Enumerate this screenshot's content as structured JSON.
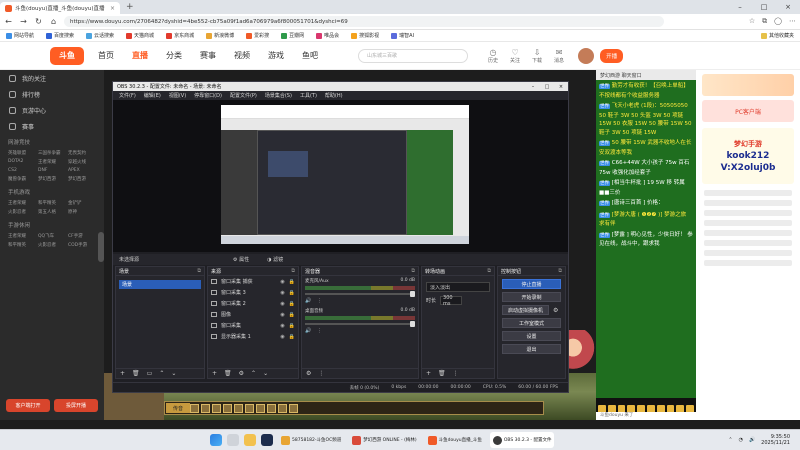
{
  "browser": {
    "tabs": [
      {
        "label": "斗鱼(douyu)直播_斗鱼(douyu)直播",
        "active": true
      },
      {
        "label": "+"
      }
    ],
    "url": "https://www.douyu.com/2706482?dyshid=4be552-cb75a09f1ad6a706979a6f800051701&dyshci=69",
    "bookmarks": [
      "网站导航",
      "百度搜索",
      "云话搜索",
      "天猫商城",
      "京东商城",
      "新浪微博",
      "爱彩搜",
      "豆瓣网",
      "唯品会",
      "搜狐影视",
      "瑞智AI"
    ],
    "bookmark_right": "其他收藏夹"
  },
  "douyu": {
    "logo": "斗鱼",
    "nav": [
      "首页",
      "直播",
      "分类",
      "赛事",
      "视频",
      "游戏",
      "鱼吧"
    ],
    "active_nav": "直播",
    "search_placeholder": "山东城三百歌",
    "header_icons": [
      "历史",
      "关注",
      "下载",
      "消息"
    ],
    "kaibo": "开播",
    "sidebar": {
      "items": [
        "我的关注",
        "排行榜",
        "页游中心",
        "赛事"
      ],
      "sections": [
        {
          "title": "网游竞技",
          "items": [
            "英雄联盟",
            "三国杀争霸",
            "无畏契约",
            "DOTA2",
            "王者荣耀",
            "穿越火线",
            "CS2",
            "DNF",
            "APEX",
            "魔兽争霸",
            "梦幻西游",
            "梦幻西游"
          ]
        },
        {
          "title": "手机游戏",
          "items": [
            "王者荣耀",
            "和平精英",
            "金铲铲",
            "火影忍者",
            "第五人格",
            "原神"
          ]
        },
        {
          "title": "手游休闲",
          "items": [
            "王者荣耀",
            "QQ飞车",
            "CF手游",
            "和平精英",
            "火影忍者",
            "COD手游"
          ]
        }
      ],
      "bottom_buttons": [
        "客户端打开",
        "投屏开播"
      ]
    }
  },
  "obs": {
    "title": "OBS 30.2.3 - 配置文件: 未命名 - 场景: 未命名",
    "menu": [
      "文件(F)",
      "编辑(E)",
      "视图(V)",
      "停靠窗口(D)",
      "配置文件(P)",
      "场景集合(S)",
      "工具(T)",
      "帮助(H)"
    ],
    "scene_label": "未选择源",
    "props_label": "属性",
    "filters_label": "滤镜",
    "docks": {
      "scenes": {
        "title": "场景",
        "items": [
          "场景"
        ]
      },
      "sources": {
        "title": "来源",
        "items": [
          "窗口采集 捕获",
          "窗口采集 3",
          "窗口采集 2",
          "图像",
          "窗口采集",
          "显示器采集 1"
        ]
      },
      "mixer": {
        "title": "混音器",
        "channels": [
          {
            "name": "麦克风/Aux",
            "db": "0.0 dB",
            "level": 0.6
          },
          {
            "name": "桌面音频",
            "db": "0.0 dB",
            "level": 0.5
          }
        ]
      },
      "transitions": {
        "title": "转场动画",
        "type": "淡入淡出",
        "duration_label": "时长",
        "duration": "300 ms"
      },
      "controls": {
        "title": "控制按钮",
        "buttons": [
          "停止直播",
          "开始录制",
          "启动虚拟摄像机",
          "工作室模式",
          "设置",
          "退出"
        ]
      }
    },
    "status": [
      "丢帧 0 (0.0%)",
      "0 kbps",
      "00:00:00",
      "00:00:00",
      "CPU: 0.5%",
      "60.00 / 60.00 FPS"
    ]
  },
  "chat": {
    "header": "梦幻西游 聊天窗口",
    "messages": [
      {
        "level": "世界",
        "text": "勤劳才有收获！【召唤上单船】不按线都有个收益服务器",
        "highlight": true
      },
      {
        "level": "世界",
        "text": "飞天小老虎 (1段)：50505050 50 鞋子 3W 50 头盔 3W 50 项链 15W 50 衣服 15W 50 腰带 15W 50 鞋子 3W 50 项链 15W",
        "highlight": true
      },
      {
        "level": "世界",
        "text": "50 腰带 15W 武器不收地人在长安双渡本等我",
        "highlight": true
      },
      {
        "level": "世界",
        "text": "C66+44W 大小孩子 75w 百石 75w 收强化加经套子",
        "highlight": false
      },
      {
        "level": "世界",
        "text": "[相当牛杯批 ] 19 5W 移 转属 ■■三价",
        "highlight": false
      },
      {
        "level": "世界",
        "text": "[唐诗三百首 ] 价格：",
        "highlight": false
      },
      {
        "level": "世界",
        "text": "[梦游大唐 ( ❶❷❼ )] 梦游之旅 求有伴",
        "highlight": true
      },
      {
        "level": "世界",
        "text": "[梦露 ] 明心见性，少侠日好！ 参见在线，战斗中，跟求我",
        "highlight": false
      }
    ],
    "footer_user": "斗鱼douyu 来了"
  },
  "right_col": {
    "ad_text": "PC客户端",
    "kook_lines": [
      "梦幻手游",
      "kook212",
      "V:X2oluj0b"
    ]
  },
  "game": {
    "input_label": "传音"
  },
  "taskbar": {
    "apps": [
      {
        "label": "58758182-斗鱼OC频道",
        "color": "#e8a533"
      },
      {
        "label": "梦幻西游 ONLINE - (梅林)",
        "color": "#d94b3a"
      },
      {
        "label": "斗鱼douyu直播_斗鱼",
        "color": "#f05a28"
      },
      {
        "label": "OBS 30.2.3 - 配置文件",
        "color": "#3b3b3b",
        "active": true
      }
    ],
    "time": "9:35:50",
    "date": "2025/11/21"
  }
}
